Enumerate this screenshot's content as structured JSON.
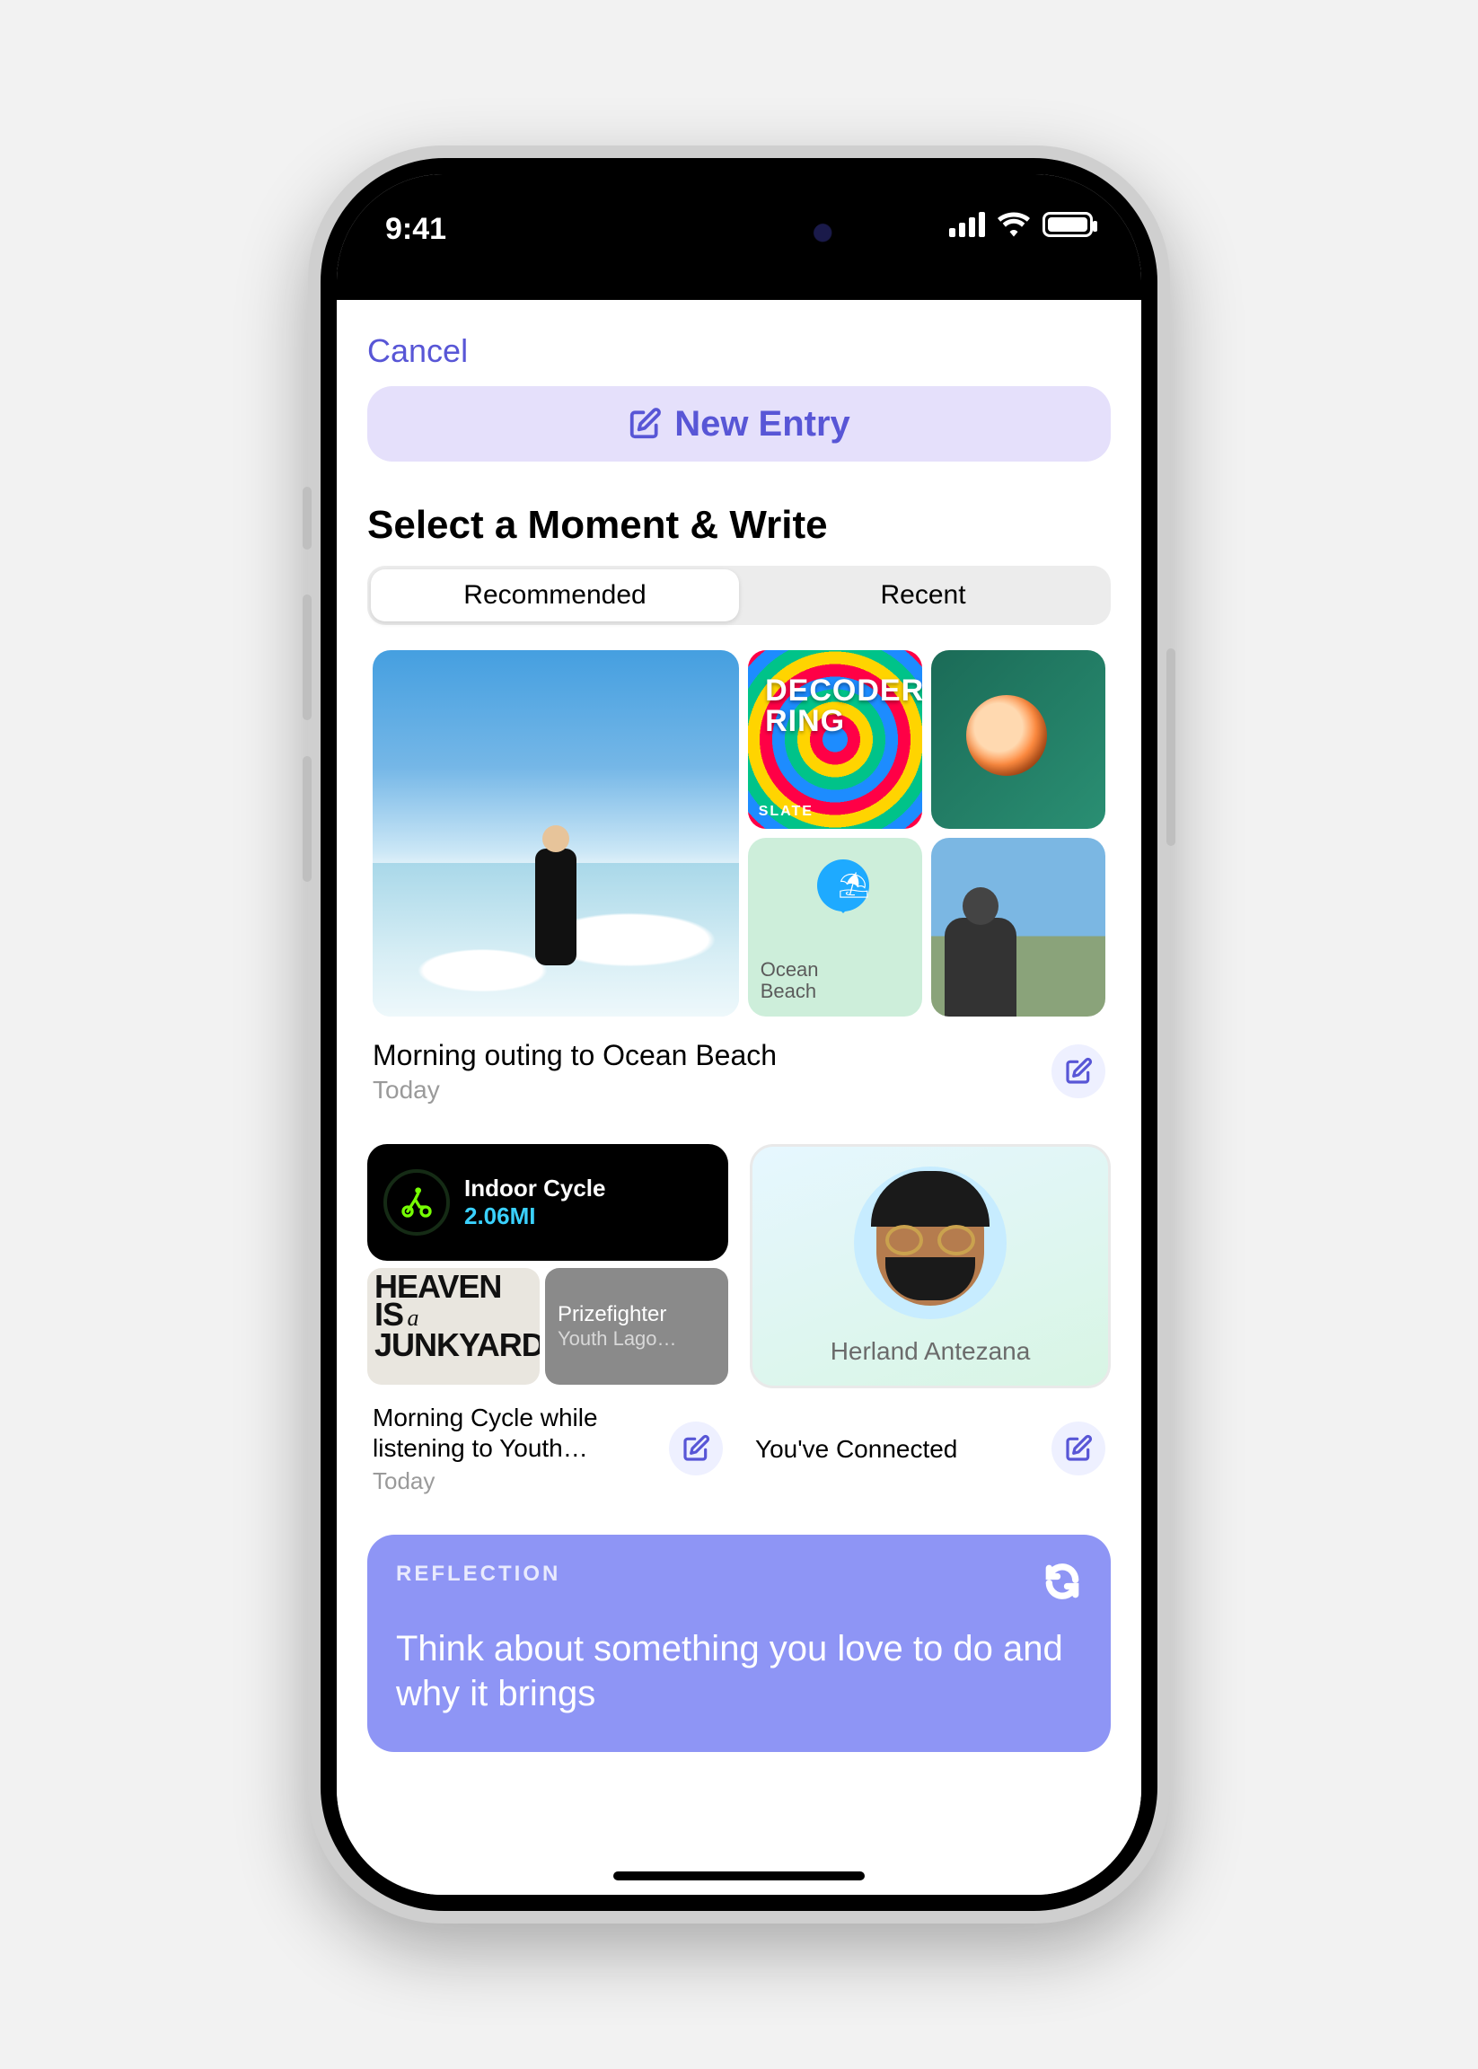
{
  "status": {
    "time": "9:41"
  },
  "modal": {
    "cancel": "Cancel",
    "newEntry": "New Entry",
    "sectionTitle": "Select a Moment & Write"
  },
  "segmented": {
    "recommended": "Recommended",
    "recent": "Recent"
  },
  "moment1": {
    "decoderLine1": "DECODER",
    "decoderLine2": "RING",
    "decoderBrand": "SLATE",
    "mapLabelLine1": "Ocean",
    "mapLabelLine2": "Beach",
    "title": "Morning outing to Ocean Beach",
    "subtitle": "Today"
  },
  "workout": {
    "name": "Indoor Cycle",
    "distance": "2.06",
    "unit": "MI"
  },
  "album": {
    "line1": "HEAVEN",
    "line2": "IS",
    "line3": "JUNKYARD",
    "a": "a",
    "track": "Prizefighter",
    "artist": "Youth Lago…"
  },
  "moment2": {
    "title": "Morning Cycle while listening to Youth…",
    "subtitle": "Today"
  },
  "contact": {
    "name": "Herland Antezana"
  },
  "moment3": {
    "title": "You've Connected"
  },
  "reflection": {
    "tag": "REFLECTION",
    "text": "Think about something you love to do and why it brings"
  }
}
